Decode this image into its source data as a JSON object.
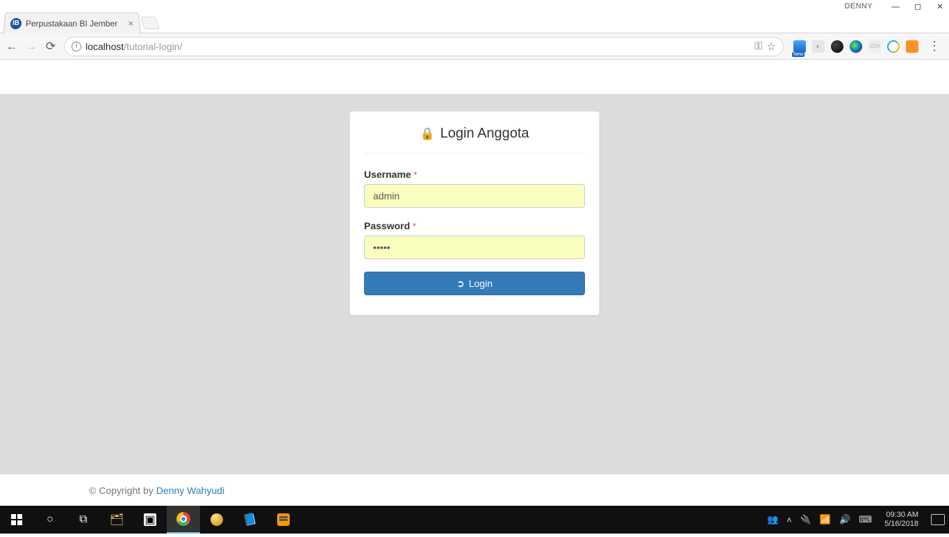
{
  "window": {
    "profile_name": "DENNY"
  },
  "browser": {
    "tab_title": "Perpustakaan BI Jember",
    "url_host": "localhost",
    "url_path": "/tutorial-login/"
  },
  "page": {
    "panel_title": "Login Anggota",
    "username_label": "Username",
    "password_label": "Password",
    "required_mark": "*",
    "username_value": "admin",
    "password_value": "•••••",
    "login_button": "Login",
    "footer_prefix": "© Copyright by",
    "footer_author": "Denny Wahyudi"
  },
  "taskbar": {
    "time": "09:30 AM",
    "date": "5/16/2018"
  }
}
